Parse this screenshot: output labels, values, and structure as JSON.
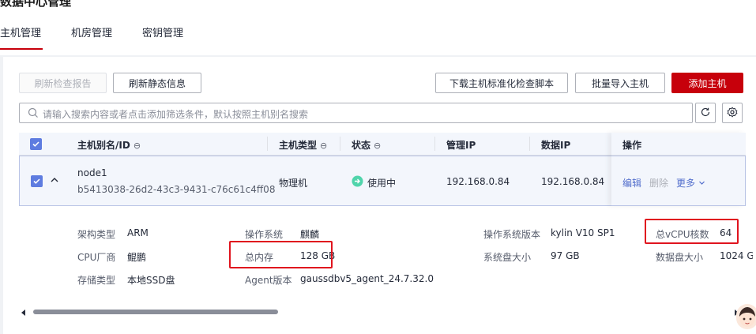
{
  "page": {
    "title": "数据中心管理",
    "tabs": [
      {
        "label": "主机管理",
        "active": true
      },
      {
        "label": "机房管理",
        "active": false
      },
      {
        "label": "密钥管理",
        "active": false
      }
    ],
    "accent_color": "#c7000b"
  },
  "toolbar": {
    "refresh_report": "刷新检查报告",
    "refresh_static": "刷新静态信息",
    "download_script": "下载主机标准化检查脚本",
    "batch_import": "批量导入主机",
    "add_host": "添加主机"
  },
  "search": {
    "placeholder": "请输入搜索内容或者点击添加筛选条件，默认按照主机别名搜索",
    "icon": "search-icon",
    "refresh_icon": "refresh-icon",
    "settings_icon": "gear-icon"
  },
  "table": {
    "columns": {
      "alias": "主机别名/ID",
      "type": "主机类型",
      "status": "状态",
      "mgmt_ip": "管理IP",
      "data_ip": "数据IP",
      "ops": "操作"
    },
    "row": {
      "name": "node1",
      "id": "b5413038-26d2-43c3-9431-c76c61c4ff08",
      "type": "物理机",
      "status": "使用中",
      "status_color": "#50d4ab",
      "mgmt_ip": "192.168.0.84",
      "data_ip": "192.168.0.84",
      "actions": {
        "edit": "编辑",
        "delete": "删除",
        "more": "更多"
      }
    }
  },
  "details": {
    "arch_label": "架构类型",
    "arch_value": "ARM",
    "cpu_vendor_label": "CPU厂商",
    "cpu_vendor_value": "鲲鹏",
    "storage_label": "存储类型",
    "storage_value": "本地SSD盘",
    "os_label": "操作系统",
    "os_value": "麒麟",
    "mem_label": "总内存",
    "mem_value": "128 GB",
    "agent_label": "Agent版本",
    "agent_value": "gaussdbv5_agent_24.7.32.0",
    "os_ver_label": "操作系统版本",
    "os_ver_value": "kylin V10 SP1",
    "sys_disk_label": "系统盘大小",
    "sys_disk_value": "97 GB",
    "vcpu_label": "总vCPU核数",
    "vcpu_value": "64",
    "data_disk_label": "数据盘大小",
    "data_disk_value": "1024 G"
  }
}
